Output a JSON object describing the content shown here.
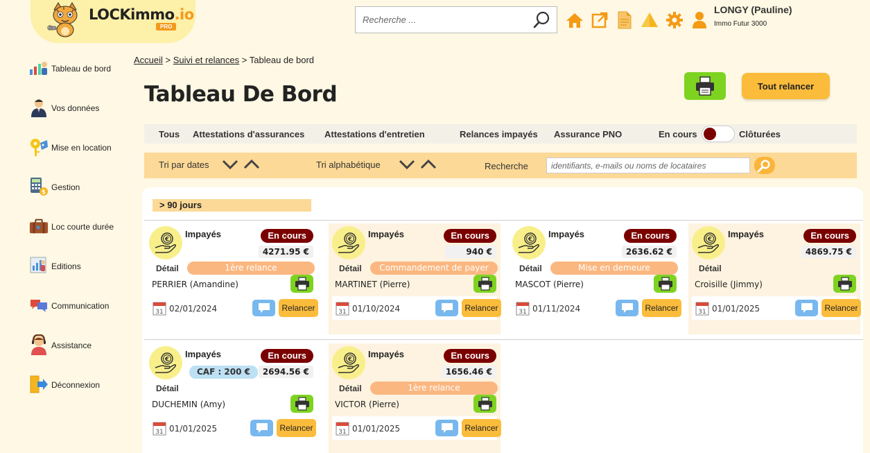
{
  "brand": {
    "name_part1": "LOCKimmo",
    "name_part2": ".io",
    "badge": "PRO"
  },
  "search": {
    "placeholder": "Recherche ..."
  },
  "top_icons": [
    "home-icon",
    "external-link-icon",
    "document-icon",
    "alert-icon",
    "gear-icon",
    "user-icon"
  ],
  "user": {
    "name": "LONGY (Pauline)",
    "agency": "Immo Futur 3000"
  },
  "sidebar": {
    "items": [
      {
        "label": "Tableau de bord",
        "icon": "dashboard-icon"
      },
      {
        "label": "Vos données",
        "icon": "person-icon"
      },
      {
        "label": "Mise en location",
        "icon": "keys-icon"
      },
      {
        "label": "Gestion",
        "icon": "calculator-icon"
      },
      {
        "label": "Loc courte durée",
        "icon": "suitcase-icon"
      },
      {
        "label": "Editions",
        "icon": "editions-icon"
      },
      {
        "label": "Communication",
        "icon": "chat-bubbles-icon"
      },
      {
        "label": "Assistance",
        "icon": "support-icon"
      },
      {
        "label": "Déconnexion",
        "icon": "logout-icon"
      }
    ]
  },
  "breadcrumb": {
    "home": "Accueil",
    "sep": ">",
    "section": "Suivi et relances",
    "current": "Tableau de bord"
  },
  "page": {
    "title": "Tableau De Bord",
    "relaunch_all": "Tout relancer"
  },
  "tabs": {
    "all": "Tous",
    "insurance": "Attestations d'assurances",
    "maintenance": "Attestations d'entretien",
    "unpaid": "Relances impayés",
    "pno": "Assurance PNO",
    "ongoing": "En cours",
    "closed": "Clôturées"
  },
  "sort": {
    "by_date": "Tri par dates",
    "alpha": "Tri alphabétique",
    "search_label": "Recherche",
    "search_placeholder": "identifiants, e-mails ou noms de locataires"
  },
  "section": {
    "title": "> 90 jours"
  },
  "cards": [
    {
      "type": "Impayés",
      "status": "En cours",
      "amount": "4271.95 €",
      "detail_label": "Détail",
      "stage": "1ère relance",
      "tenant": "PERRIER (Amandine)",
      "date": "02/01/2024",
      "relaunch": "Relancer",
      "cal_day": "31"
    },
    {
      "type": "Impayés",
      "status": "En cours",
      "amount": "940 €",
      "detail_label": "Détail",
      "stage": "Commandement de payer",
      "tenant": "MARTINET (Pierre)",
      "date": "01/10/2024",
      "relaunch": "Relancer",
      "cal_day": "31"
    },
    {
      "type": "Impayés",
      "status": "En cours",
      "amount": "2636.62 €",
      "detail_label": "Détail",
      "stage": "Mise en demeure",
      "tenant": "MASCOT (Pierre)",
      "date": "01/11/2024",
      "relaunch": "Relancer",
      "cal_day": "31"
    },
    {
      "type": "Impayés",
      "status": "En cours",
      "amount": "4869.75 €",
      "detail_label": "Détail",
      "stage": "",
      "tenant": "Croisille (Jimmy)",
      "date": "01/01/2025",
      "relaunch": "Relancer",
      "cal_day": "31"
    },
    {
      "type": "Impayés",
      "status": "En cours",
      "amount": "2694.56 €",
      "caf": "CAF : 200 €",
      "detail_label": "Détail",
      "stage": "",
      "tenant": "DUCHEMIN (Amy)",
      "date": "01/01/2025",
      "relaunch": "Relancer",
      "cal_day": "31"
    },
    {
      "type": "Impayés",
      "status": "En cours",
      "amount": "1656.46 €",
      "detail_label": "Détail",
      "stage": "1ère relance",
      "tenant": "VICTOR (Pierre)",
      "date": "01/01/2025",
      "relaunch": "Relancer",
      "cal_day": "31"
    }
  ],
  "colors": {
    "accent": "#fbbc3c",
    "status_badge": "#7a0000",
    "print_green": "#7ed321",
    "stage_pill": "#fbb780",
    "chat_blue": "#78b8ee",
    "page_bg": "#fef8e4"
  }
}
